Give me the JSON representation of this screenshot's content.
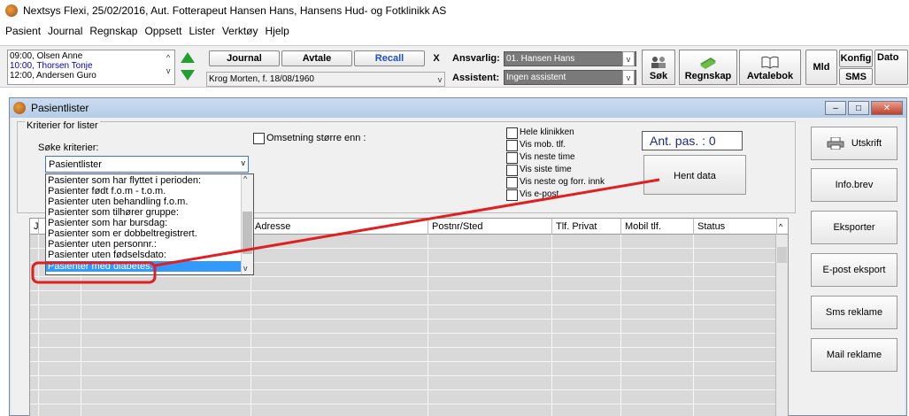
{
  "window_title": "Nextsys Flexi,  25/02/2016, Aut. Fotterapeut Hansen Hans, Hansens Hud- og Fotklinikk AS",
  "menu": [
    "Pasient",
    "Journal",
    "Regnskap",
    "Oppsett",
    "Lister",
    "Verktøy",
    "Hjelp"
  ],
  "appointments": [
    {
      "time_name": "09:00, Olsen Anne",
      "color": "#000000"
    },
    {
      "time_name": "10:00, Thorsen Tonje",
      "color": "#0000cc"
    },
    {
      "time_name": "12:00, Andersen Guro",
      "color": "#000000"
    }
  ],
  "toolbar": {
    "journal": "Journal",
    "avtale": "Avtale",
    "recall": "Recall",
    "close_x": "X",
    "patient_field": "Krog Morten, f. 18/08/1960",
    "ansvarlig_label": "Ansvarlig:",
    "ansvarlig_value": "01. Hansen Hans",
    "assistent_label": "Assistent:",
    "assistent_value": "Ingen assistent",
    "sok": "Søk",
    "regnskap": "Regnskap",
    "avtalebok": "Avtalebok",
    "mld": "Mld",
    "konfig": "Konfig",
    "sms": "SMS",
    "dato": "Dato"
  },
  "dialog": {
    "title": "Pasientlister",
    "group_label": "Kriterier for lister",
    "search_label": "Søke kriterier:",
    "combo_value": "Pasientlister",
    "omsetning_label": "Omsetning større enn :",
    "checkboxes": [
      "Hele klinikken",
      "Vis mob. tlf.",
      "Vis neste time",
      "Vis siste time",
      "Vis neste og forr. innk",
      "Vis e-post"
    ],
    "counter": "Ant. pas. : 0",
    "hent_data": "Hent data",
    "side_buttons": [
      "Utskrift",
      "Info.brev",
      "Eksporter",
      "E-post eksport",
      "Sms reklame",
      "Mail reklame"
    ],
    "dropdown_options": [
      "Pasienter som har flyttet i perioden:",
      "Pasienter født f.o.m - t.o.m.",
      "Pasienter uten behandling f.o.m.",
      "Pasienter som tilhører gruppe:",
      "Pasienter som har bursdag:",
      "Pasienter som er dobbeltregistrert.",
      "Pasienter uten personnr.:",
      "Pasienter uten fødselsdato:",
      "Pasienter med diabetes:"
    ],
    "selected_option": "Pasienter med diabetes:",
    "grid_columns": [
      "J",
      "",
      "Adresse",
      "Postnr/Sted",
      "Tlf. Privat",
      "Mobil tlf.",
      "Status"
    ]
  },
  "colors": {
    "selection": "#3399ff",
    "annotation": "#e02020",
    "recall": "#1a4fd0",
    "nav_arrow": "#1fa030"
  }
}
